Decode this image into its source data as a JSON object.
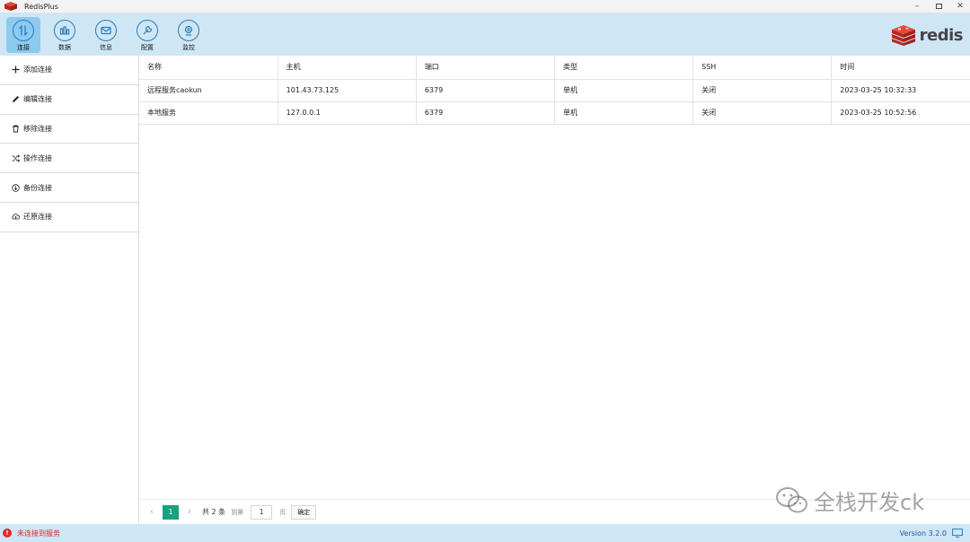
{
  "window": {
    "title": "RedisPlus"
  },
  "toolbar": {
    "items": [
      {
        "label": "连接",
        "icon": "connection-icon",
        "active": true
      },
      {
        "label": "数据",
        "icon": "data-icon",
        "active": false
      },
      {
        "label": "信息",
        "icon": "mail-icon",
        "active": false
      },
      {
        "label": "配置",
        "icon": "wrench-icon",
        "active": false
      },
      {
        "label": "监控",
        "icon": "monitor-icon",
        "active": false
      }
    ],
    "brand_text": "redis",
    "brand_color": "#d82c20"
  },
  "sidebar": {
    "items": [
      {
        "label": "添加连接",
        "icon": "plus-icon"
      },
      {
        "label": "编辑连接",
        "icon": "pencil-icon"
      },
      {
        "label": "移除连接",
        "icon": "trash-icon"
      },
      {
        "label": "操作连接",
        "icon": "shuffle-icon"
      },
      {
        "label": "备份连接",
        "icon": "download-icon"
      },
      {
        "label": "还原连接",
        "icon": "cloud-icon"
      }
    ]
  },
  "table": {
    "headers": [
      "名称",
      "主机",
      "端口",
      "类型",
      "SSH",
      "时间"
    ],
    "rows": [
      [
        "远程服务caokun",
        "101.43.73.125",
        "6379",
        "单机",
        "关闭",
        "2023-03-25 10:32:33"
      ],
      [
        "本地服务",
        "127.0.0.1",
        "6379",
        "单机",
        "关闭",
        "2023-03-25 10:52:56"
      ]
    ]
  },
  "pager": {
    "prev": "‹",
    "current": "1",
    "next": "›",
    "total": "共 2 条",
    "goto": "到第",
    "input_value": "1",
    "page_unit": "页",
    "confirm": "确定"
  },
  "watermark": {
    "text": "全栈开发ck"
  },
  "status": {
    "icon": "!",
    "message": "未连接到服务",
    "version": "Version 3.2.0",
    "error_color": "#e02828",
    "accent_color": "#1aa07f"
  }
}
